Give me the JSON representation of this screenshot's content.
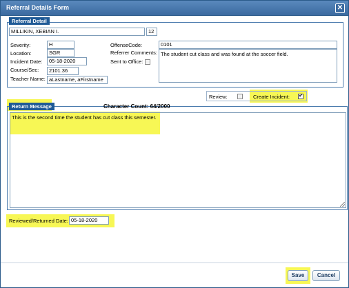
{
  "dialog": {
    "title": "Referral Details Form"
  },
  "referral_detail": {
    "legend": "Referral Detail",
    "student_name": "MILLIKIN, XEBIAN I.",
    "grade": "12",
    "severity_label": "Severity:",
    "severity": "H",
    "location_label": "Location:",
    "location": "SGR",
    "incident_date_label": "Incident Date:",
    "incident_date": "05-18-2020",
    "course_label": "Course/Sec:",
    "course": "2101.36",
    "teacher_label": "Teacher Name:",
    "teacher": "aLastname, aFirstname",
    "offense_code_label": "OffenseCode:",
    "offense_code": "0101",
    "referrer_comments_label": "Referrer Comments:",
    "referrer_comments": "The student cut class and was found at the soccer field.",
    "sent_to_office_label": "Sent to Office:",
    "sent_to_office_checked": false
  },
  "review": {
    "review_label": "Review:",
    "review_checked": false,
    "create_incident_label": "Create Incident:",
    "create_incident_checked": true
  },
  "return_message": {
    "legend": "Return Message",
    "char_count": "Character Count: 64/2000",
    "text": "This is the second time the student has cut class this semester."
  },
  "reviewed_date": {
    "label": "Reviewed/Returned Date:",
    "value": "05-18-2020"
  },
  "buttons": {
    "save": "Save",
    "cancel": "Cancel"
  },
  "colors": {
    "title_bar": "#3b6aa0",
    "legend_bg": "#1f5a96",
    "highlight": "#f7f755"
  }
}
